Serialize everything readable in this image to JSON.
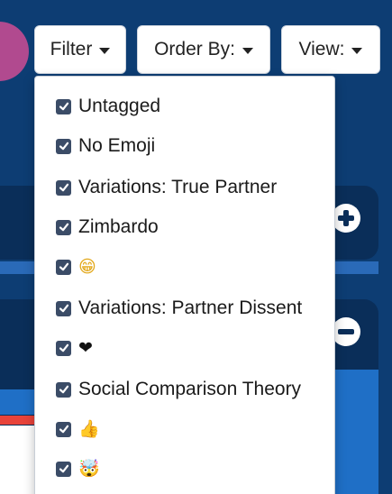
{
  "toolbar": {
    "filter_label": "Filter",
    "order_label": "Order By:",
    "view_label": "View:"
  },
  "filter_menu": {
    "items": [
      {
        "label": "Untagged",
        "checked": true
      },
      {
        "label": "No Emoji",
        "checked": true
      },
      {
        "label": "Variations: True Partner",
        "checked": true
      },
      {
        "label": "Zimbardo",
        "checked": true
      },
      {
        "label": "😁",
        "checked": true,
        "icon": "grinning-face-icon"
      },
      {
        "label": "Variations: Partner Dissent",
        "checked": true
      },
      {
        "label": "❤",
        "checked": true,
        "icon": "heart-icon"
      },
      {
        "label": "Social Comparison Theory",
        "checked": true
      },
      {
        "label": "👍",
        "checked": true,
        "icon": "thumbs-up-icon"
      },
      {
        "label": "🤯",
        "checked": true,
        "icon": "exploding-head-icon"
      }
    ]
  },
  "colors": {
    "background": "#0d3d73",
    "panel": "#0a2e59",
    "accent_blue": "#1f6fc6",
    "checkbox": "#3b4c67",
    "pointer": "#b14a8f",
    "alert_red": "#e8433a"
  },
  "icons": {
    "expand": "plus-circle-icon",
    "collapse": "minus-circle-icon"
  }
}
